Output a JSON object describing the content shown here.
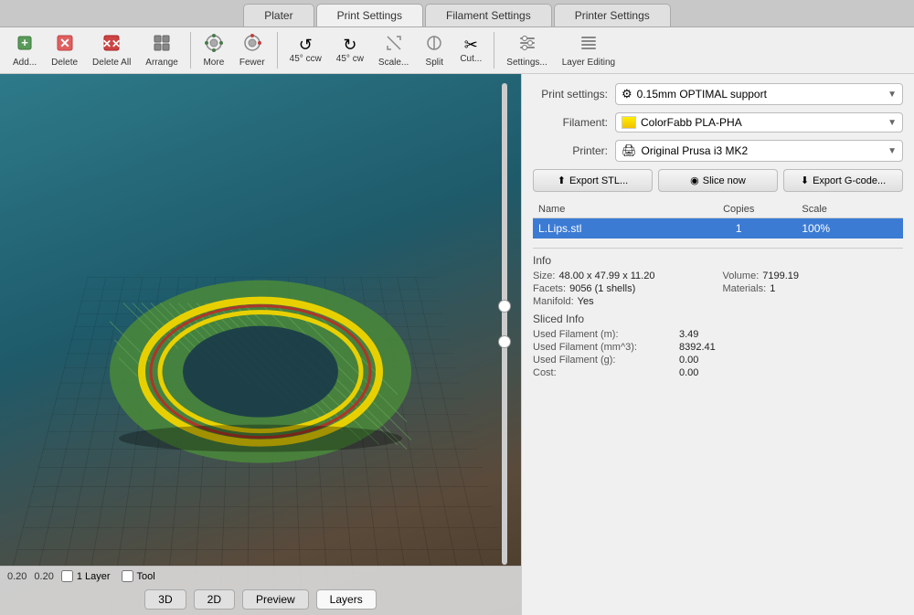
{
  "tabs": {
    "items": [
      "Plater",
      "Print Settings",
      "Filament Settings",
      "Printer Settings"
    ],
    "active": "Plater"
  },
  "toolbar": {
    "buttons": [
      {
        "id": "add",
        "icon": "➕",
        "label": "Add..."
      },
      {
        "id": "delete",
        "icon": "🗑",
        "label": "Delete"
      },
      {
        "id": "delete-all",
        "icon": "✖",
        "label": "Delete All"
      },
      {
        "id": "arrange",
        "icon": "⊞",
        "label": "Arrange"
      },
      {
        "id": "more",
        "icon": "◎",
        "label": "More"
      },
      {
        "id": "fewer",
        "icon": "⊖",
        "label": "Fewer"
      },
      {
        "id": "rotate-ccw",
        "icon": "↺",
        "label": "45° ccw"
      },
      {
        "id": "rotate-cw",
        "icon": "↻",
        "label": "45° cw"
      },
      {
        "id": "scale",
        "icon": "⤢",
        "label": "Scale..."
      },
      {
        "id": "split",
        "icon": "⊘",
        "label": "Split"
      },
      {
        "id": "cut",
        "icon": "✂",
        "label": "Cut..."
      },
      {
        "id": "settings",
        "icon": "⚙",
        "label": "Settings..."
      },
      {
        "id": "layer-editing",
        "icon": "≡",
        "label": "Layer Editing"
      }
    ]
  },
  "viewport": {
    "layer_left": "0.20",
    "layer_right": "0.20",
    "layer_label": "1 Layer",
    "tool_label": "Tool"
  },
  "view_buttons": [
    "3D",
    "2D",
    "Preview",
    "Layers"
  ],
  "active_view": "Layers",
  "right_panel": {
    "print_settings_label": "Print settings:",
    "print_settings_value": "0.15mm OPTIMAL support",
    "print_settings_icon": "⚙",
    "filament_label": "Filament:",
    "filament_value": "ColorFabb PLA-PHA",
    "printer_label": "Printer:",
    "printer_value": "Original Prusa i3 MK2",
    "printer_icon": "🖨",
    "buttons": {
      "export_stl": "Export STL...",
      "slice_now": "Slice now",
      "export_gcode": "Export G-code..."
    },
    "table": {
      "headers": [
        "Name",
        "Copies",
        "Scale"
      ],
      "rows": [
        {
          "name": "L.Lips.stl",
          "copies": "1",
          "scale": "100%",
          "selected": true
        }
      ]
    },
    "info": {
      "title": "Info",
      "size_label": "Size:",
      "size_value": "48.00 x 47.99 x 11.20",
      "volume_label": "Volume:",
      "volume_value": "7199.19",
      "facets_label": "Facets:",
      "facets_value": "9056 (1 shells)",
      "materials_label": "Materials:",
      "materials_value": "1",
      "manifold_label": "Manifold:",
      "manifold_value": "Yes"
    },
    "sliced": {
      "title": "Sliced Info",
      "rows": [
        {
          "key": "Used Filament (m):",
          "value": "3.49"
        },
        {
          "key": "Used Filament (mm^3):",
          "value": "8392.41"
        },
        {
          "key": "Used Filament (g):",
          "value": "0.00"
        },
        {
          "key": "Cost:",
          "value": "0.00"
        }
      ]
    }
  }
}
